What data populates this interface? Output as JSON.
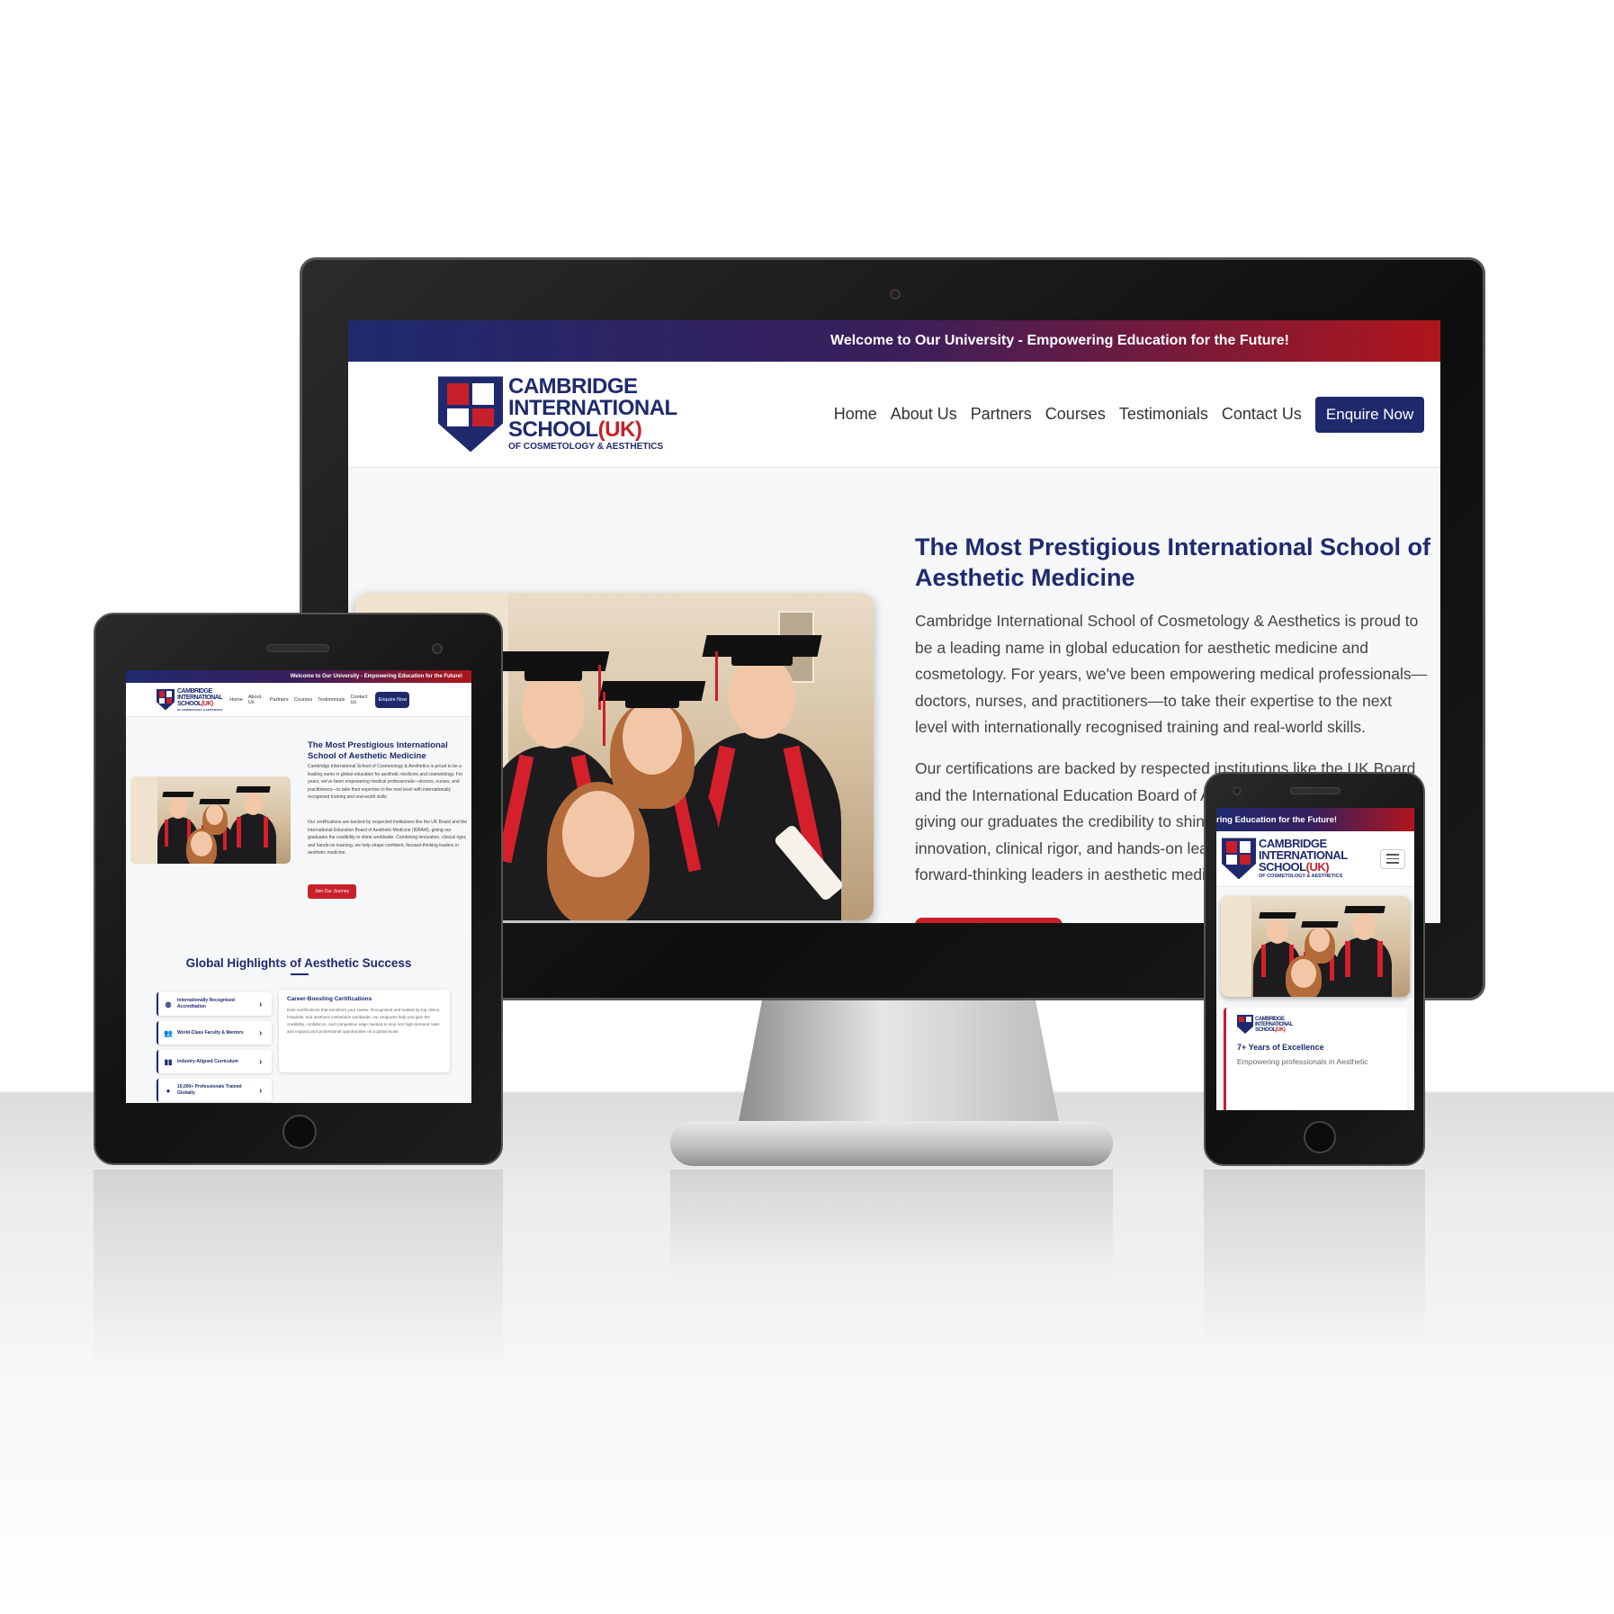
{
  "site": {
    "topbar_text": "Welcome to Our University - Empowering Education for the Future!",
    "topbar_text_phone": "ring Education for the Future!",
    "logo": {
      "line1": "CAMBRIDGE",
      "line2": "INTERNATIONAL",
      "line3": "SCHOOL",
      "uk": "(UK)",
      "line4": "OF COSMETOLOGY & AESTHETICS"
    },
    "nav": [
      {
        "label": "Home"
      },
      {
        "label": "About Us"
      },
      {
        "label": "Partners"
      },
      {
        "label": "Courses"
      },
      {
        "label": "Testimonials"
      },
      {
        "label": "Contact Us"
      }
    ],
    "enquire_label": "Enquire Now",
    "hero": {
      "title": "The Most Prestigious International School of Aesthetic Medicine",
      "p1": "Cambridge International School of Cosmetology & Aesthetics is proud to be a leading name in global education for aesthetic medicine and cosmetology. For years, we've been empowering medical professionals—doctors, nurses, and practitioners—to take their expertise to the next level with internationally recognised training and real-world skills.",
      "p2": "Our certifications are backed by respected institutions like the UK Board and the International Education Board of Aesthetic Medicine (IEBAM), giving our graduates the credibility to shine worldwide. Combining innovation, clinical rigor, and hands-on learning, we help shape confident, forward-thinking leaders in aesthetic medicine.",
      "join_label": "Join Our Journey"
    },
    "highlights": {
      "title": "Global Highlights of Aesthetic Success",
      "items": [
        {
          "icon": "globe-icon",
          "label": "Internationally Recognised Accreditation"
        },
        {
          "icon": "people-icon",
          "label": "World-Class Faculty & Mentors"
        },
        {
          "icon": "book-icon",
          "label": "Industry-Aligned Curriculum"
        },
        {
          "icon": "person-icon",
          "label": "10,000+ Professionals Trained Globally"
        }
      ],
      "card": {
        "title": "Career-Boosting Certifications",
        "body": "Earn certifications that transform your career. Recognised and trusted by top clinics, hospitals, and aesthetic institutions worldwide, our programs help you gain the credibility, confidence, and competitive edge needed to step into high-demand roles and expand your professional opportunities on a global scale."
      }
    },
    "phone_card": {
      "title": "7+ Years of Excellence",
      "body": "Empowering professionals in Aesthetic"
    }
  },
  "colors": {
    "brand_navy": "#1f2a6e",
    "brand_red": "#c8202a"
  }
}
